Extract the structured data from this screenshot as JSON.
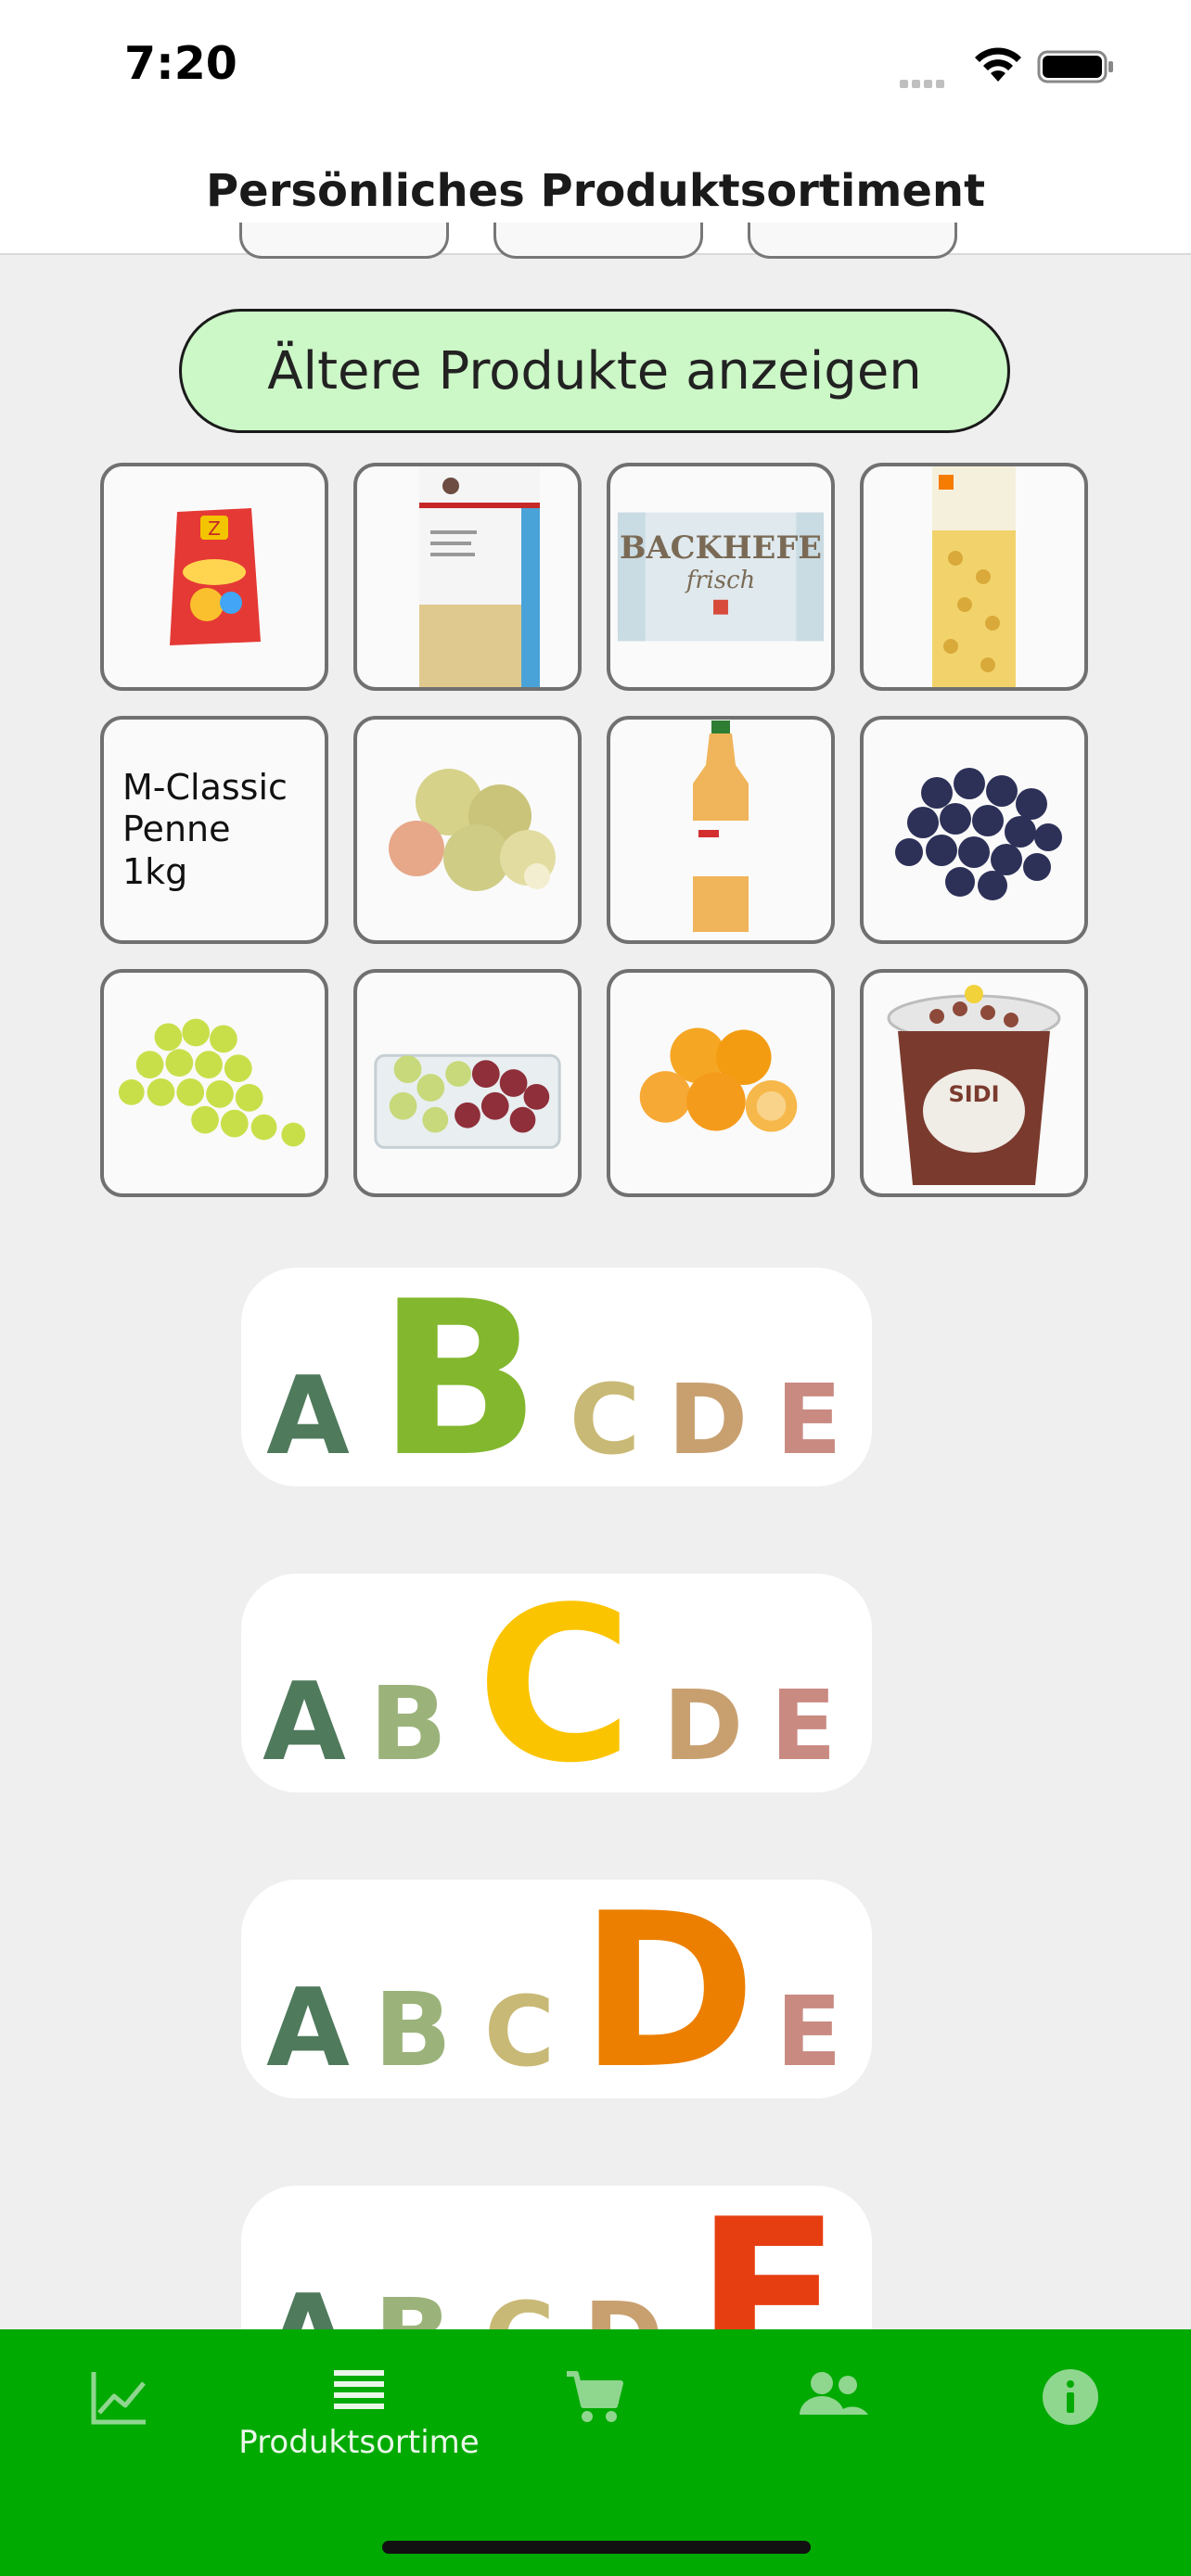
{
  "status_bar": {
    "time": "7:20"
  },
  "header": {
    "title": "Persönliches Produktsortiment"
  },
  "older_button": {
    "label": "Ältere Produkte anzeigen"
  },
  "products": [
    {
      "name": "chips-bag",
      "kind": "image"
    },
    {
      "name": "flour-bag",
      "kind": "image"
    },
    {
      "name": "backhefe-frisch",
      "kind": "image"
    },
    {
      "name": "pasta-pack",
      "kind": "image"
    },
    {
      "name": "m-classic-penne",
      "kind": "text",
      "text": "M-Classic Penne 1kg"
    },
    {
      "name": "apples",
      "kind": "image"
    },
    {
      "name": "iced-tea-bottle",
      "kind": "image"
    },
    {
      "name": "dark-grapes",
      "kind": "image"
    },
    {
      "name": "white-grapes",
      "kind": "image"
    },
    {
      "name": "mixed-grapes-box",
      "kind": "image"
    },
    {
      "name": "mandarins",
      "kind": "image"
    },
    {
      "name": "candy-yogurt-cup",
      "kind": "image"
    }
  ],
  "nutri_scores": [
    {
      "grade": "B",
      "letters": [
        "A",
        "B",
        "C",
        "D",
        "E"
      ]
    },
    {
      "grade": "C",
      "letters": [
        "A",
        "B",
        "C",
        "D",
        "E"
      ]
    },
    {
      "grade": "D",
      "letters": [
        "A",
        "B",
        "C",
        "D",
        "E"
      ]
    },
    {
      "grade": "E",
      "letters": [
        "A",
        "B",
        "C",
        "D",
        "E"
      ]
    }
  ],
  "colors": {
    "A": "#1e5c3a",
    "B": "#7ab51d",
    "C": "#fecb02",
    "D": "#ee8100",
    "E": "#e63e11",
    "tabbar": "#00aa00",
    "button_bg": "#ccf7c7"
  },
  "tabbar": {
    "tabs": [
      {
        "icon": "chart-icon",
        "label": ""
      },
      {
        "icon": "list-icon",
        "label": "Produktsortime",
        "active": true
      },
      {
        "icon": "cart-icon",
        "label": ""
      },
      {
        "icon": "people-icon",
        "label": ""
      },
      {
        "icon": "info-icon",
        "label": ""
      }
    ]
  }
}
